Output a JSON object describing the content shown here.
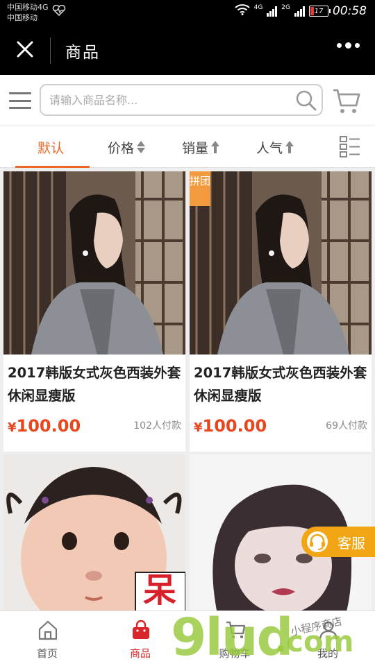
{
  "status_bar": {
    "carrier1": "中国移动4G",
    "carrier2": "中国移动",
    "net1": "4G",
    "net2": "2G",
    "battery": "17",
    "time": "00:58"
  },
  "header": {
    "title": "商品",
    "close_icon": "close-icon",
    "more_icon": "more-icon"
  },
  "search": {
    "placeholder": "请输入商品名称..."
  },
  "sort_tabs": [
    {
      "label": "默认"
    },
    {
      "label": "价格"
    },
    {
      "label": "销量"
    },
    {
      "label": "人气"
    }
  ],
  "products": [
    {
      "name": "2017韩版女式灰色西装外套休闲显瘦版",
      "price": "100.00",
      "currency": "¥",
      "sold": "102人付款",
      "tag": ""
    },
    {
      "name": "2017韩版女式灰色西装外套休闲显瘦版",
      "price": "100.00",
      "currency": "¥",
      "sold": "69人付款",
      "tag": "拼团"
    },
    {
      "name": "",
      "overlay_text": "呆"
    },
    {
      "name": ""
    }
  ],
  "service": {
    "label": "客服"
  },
  "tabbar": [
    {
      "label": "首页",
      "icon": "home-icon"
    },
    {
      "label": "商品",
      "icon": "bag-icon"
    },
    {
      "label": "购物车",
      "icon": "cart-icon"
    },
    {
      "label": "我的",
      "icon": "user-icon"
    }
  ],
  "watermark": {
    "main": "9lud",
    "domain": ".com",
    "handwriting": "小程序商店"
  },
  "colors": {
    "accent": "#e8692a",
    "price": "#e8461c",
    "tab_active": "#d8262a",
    "service": "#f2a615",
    "tag": "#f29a3d"
  }
}
